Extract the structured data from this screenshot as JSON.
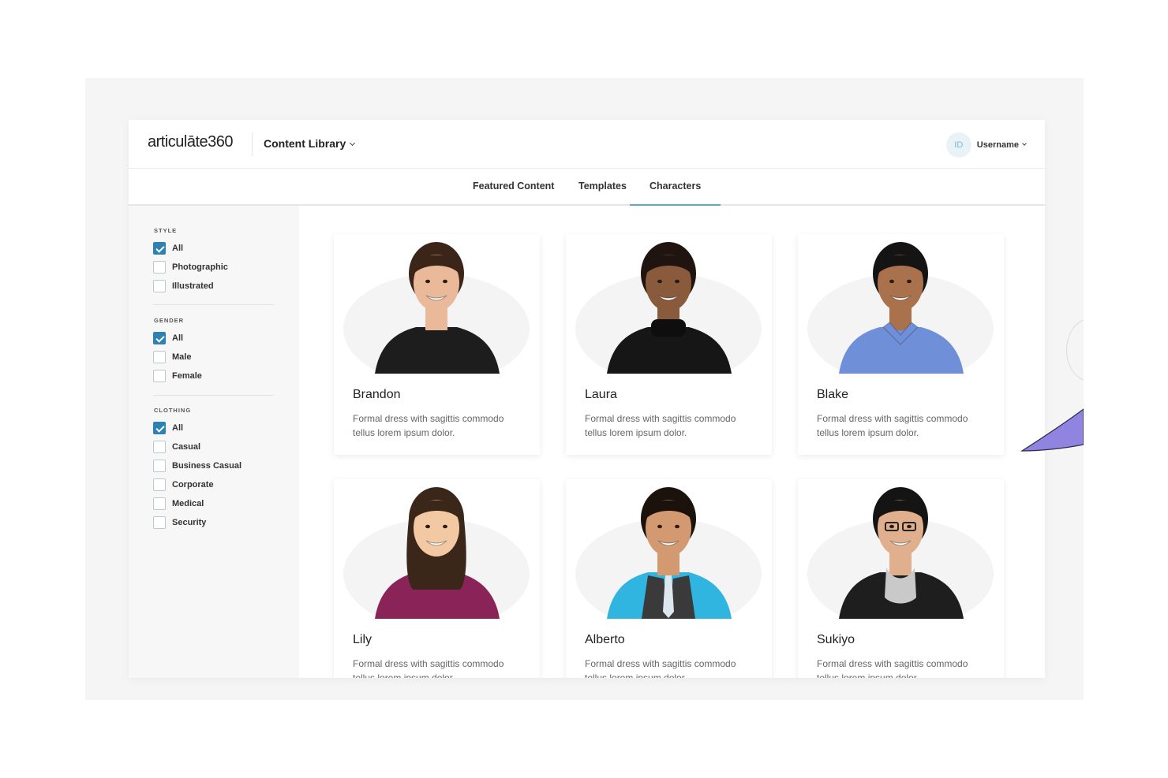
{
  "header": {
    "logo_word": "articulāte",
    "logo_num": "360",
    "library_menu": "Content Library",
    "avatar_initials": "ID",
    "username": "Username"
  },
  "tabs": [
    {
      "label": "Featured Content"
    },
    {
      "label": "Templates"
    },
    {
      "label": "Characters"
    }
  ],
  "filters": {
    "style": {
      "title": "STYLE",
      "options": [
        {
          "label": "All",
          "checked": true
        },
        {
          "label": "Photographic",
          "checked": false
        },
        {
          "label": "Illustrated",
          "checked": false
        }
      ]
    },
    "gender": {
      "title": "GENDER",
      "options": [
        {
          "label": "All",
          "checked": true
        },
        {
          "label": "Male",
          "checked": false
        },
        {
          "label": "Female",
          "checked": false
        }
      ]
    },
    "clothing": {
      "title": "CLOTHING",
      "options": [
        {
          "label": "All",
          "checked": true
        },
        {
          "label": "Casual",
          "checked": false
        },
        {
          "label": "Business Casual",
          "checked": false
        },
        {
          "label": "Corporate",
          "checked": false
        },
        {
          "label": "Medical",
          "checked": false
        },
        {
          "label": "Security",
          "checked": false
        }
      ]
    }
  },
  "characters": [
    {
      "name": "Brandon",
      "description": "Formal dress with sagittis commodo tellus lorem ipsum dolor.",
      "skin": "#e9b999",
      "hair": "#3a2518",
      "shirt": "#1d1d1d",
      "collar": "none"
    },
    {
      "name": "Laura",
      "description": "Formal dress with sagittis commodo tellus lorem ipsum dolor.",
      "skin": "#8a5a3c",
      "hair": "#1f1410",
      "shirt": "#161616",
      "collar": "turtle"
    },
    {
      "name": "Blake",
      "description": "Formal dress with sagittis commodo tellus lorem ipsum dolor.",
      "skin": "#a9724c",
      "hair": "#141414",
      "shirt": "#6f8fd8",
      "collar": "shirt"
    },
    {
      "name": "Lily",
      "description": "Formal dress with sagittis commodo tellus lorem ipsum dolor.",
      "skin": "#f2c9a2",
      "hair": "#3b261a",
      "shirt": "#8a2458",
      "collar": "shirt"
    },
    {
      "name": "Alberto",
      "description": "Formal dress with sagittis commodo tellus lorem ipsum dolor.",
      "skin": "#d39a72",
      "hair": "#1c120c",
      "shirt": "#2fb5e0",
      "collar": "vest"
    },
    {
      "name": "Sukiyo",
      "description": "Formal dress with sagittis commodo tellus lorem ipsum dolor.",
      "skin": "#e0b08e",
      "hair": "#141414",
      "shirt": "#1e1e1e",
      "collar": "scarf"
    }
  ],
  "colors": {
    "accent": "#2d82b3",
    "tab_underline": "#5fa8c9"
  }
}
